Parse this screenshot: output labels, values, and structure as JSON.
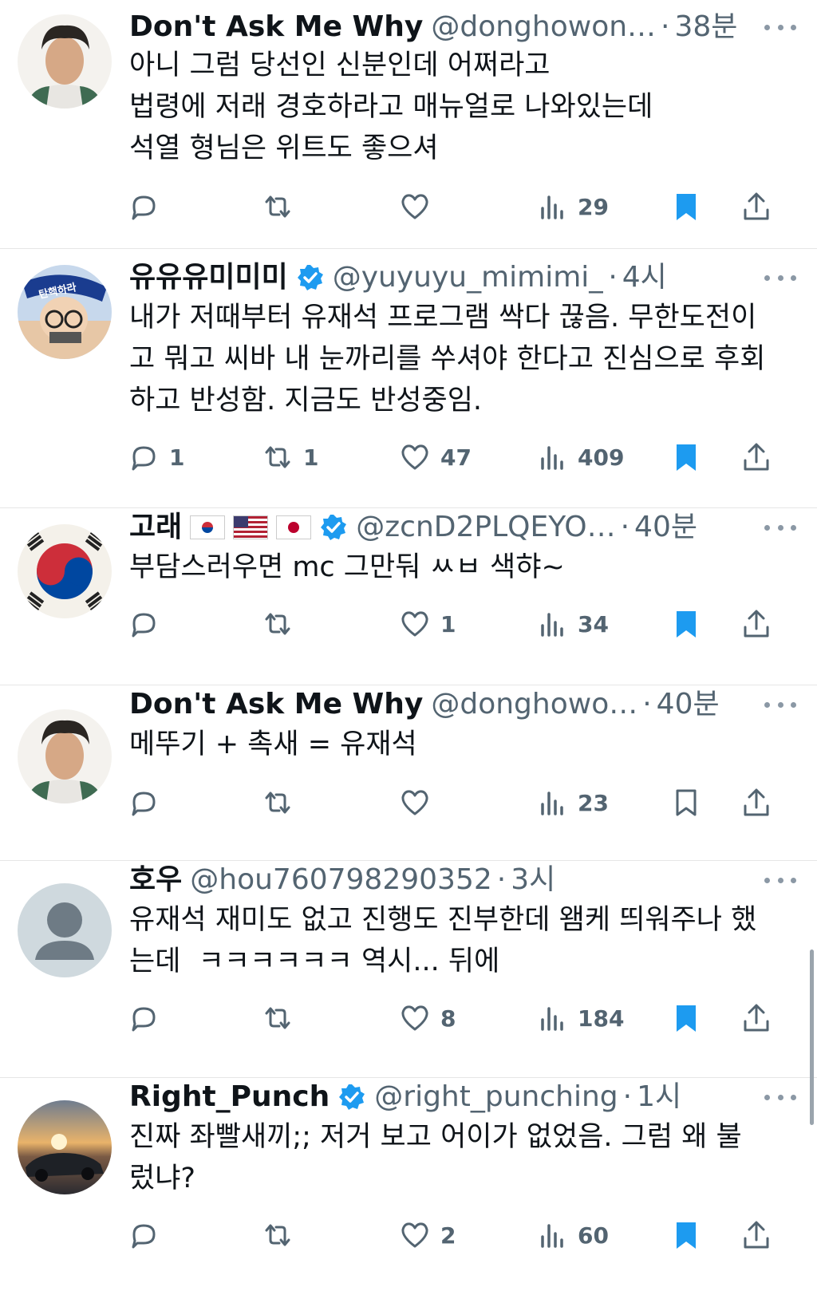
{
  "colors": {
    "bookmark_active": "#1d9bf0",
    "muted": "#536471",
    "verified": "#1d9bf0"
  },
  "tweets": [
    {
      "name": "Don't Ask Me Why",
      "handle": "@donghowon…",
      "time": "38분",
      "text": "아니 그럼 당선인 신분인데 어쩌라고\n법령에 저래 경호하라고 매뉴얼로 나와있는데\n석열 형님은 위트도 좋으셔",
      "replies": "",
      "retweets": "",
      "likes": "",
      "views": "29",
      "bookmarked": true,
      "verified": false
    },
    {
      "name": "유유유미미미",
      "handle": "@yuyuyu_mimimi_",
      "time": "4시",
      "text": "내가 저때부터 유재석 프로그램 싹다 끊음. 무한도전이\n고 뭐고 씨바 내 눈까리를 쑤셔야 한다고 진심으로 후회\n하고 반성함. 지금도 반성중임.",
      "replies": "1",
      "retweets": "1",
      "likes": "47",
      "views": "409",
      "bookmarked": true,
      "verified": true,
      "avatar_text": "탄핵하라"
    },
    {
      "name": "고래",
      "handle": "@zcnD2PLQEYO…",
      "time": "40분",
      "text": "부담스러우면 mc 그만둬 ㅆㅂ 색햐~",
      "replies": "",
      "retweets": "",
      "likes": "1",
      "views": "34",
      "bookmarked": true,
      "verified": true
    },
    {
      "name": "Don't Ask Me Why",
      "handle": "@donghowo…",
      "time": "40분",
      "text": "메뚜기 + 촉새 = 유재석",
      "replies": "",
      "retweets": "",
      "likes": "",
      "views": "23",
      "bookmarked": false,
      "verified": false
    },
    {
      "name": "호우",
      "handle": "@hou760798290352",
      "time": "3시",
      "text": "유재석 재미도 없고 진행도 진부한데 왬케 띄워주나 했\n는데  ㅋㅋㅋㅋㅋㅋ 역시... 뒤에",
      "replies": "",
      "retweets": "",
      "likes": "8",
      "views": "184",
      "bookmarked": true,
      "verified": false
    },
    {
      "name": "Right_Punch",
      "handle": "@right_punching",
      "time": "1시",
      "text": "진짜 좌빨새끼;; 저거 보고 어이가 없었음. 그럼 왜 불\n렀냐?",
      "replies": "",
      "retweets": "",
      "likes": "2",
      "views": "60",
      "bookmarked": true,
      "verified": true
    }
  ]
}
